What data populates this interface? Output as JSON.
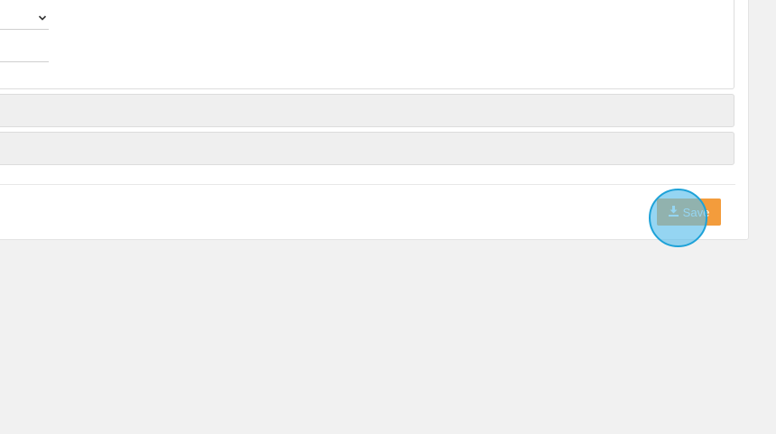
{
  "form": {
    "select_value": "",
    "text_value": ""
  },
  "panels": [
    {
      "label": ""
    },
    {
      "label": ""
    }
  ],
  "footer": {
    "save_label": "Save"
  },
  "colors": {
    "page_background": "#f1f1f1",
    "save_button": "#f39c3c",
    "click_marker": "#1ea2d8"
  },
  "icons": {
    "select_chevron": "chevron-down-icon",
    "save": "download-icon"
  }
}
